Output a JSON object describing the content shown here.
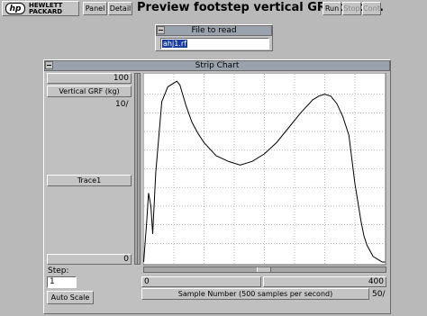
{
  "logo": {
    "line1": "HEWLETT",
    "line2": "PACKARD",
    "symbol": "hp"
  },
  "toolbar": {
    "panel_label": "Panel",
    "detail_label": "Detail",
    "run_label": "Run",
    "stop_label": "Stop",
    "cont_label": "Cont"
  },
  "app": {
    "title": "Preview footstep vertical GRF traces."
  },
  "file_panel": {
    "title": "File to read",
    "value": "ahj1.rf"
  },
  "strip_chart": {
    "title": "Strip Chart",
    "y_max": "100",
    "y_label": "Vertical GRF (kg)",
    "y_per_div": "10/",
    "trace_label": "Trace1",
    "y_min": "0",
    "step_label": "Step:",
    "step_value": "1",
    "auto_scale_label": "Auto Scale",
    "x_min": "0",
    "x_max": "400",
    "x_label": "Sample Number (500 samples per second)",
    "x_per_div": "50/"
  },
  "colors": {
    "background": "#b9b9b9",
    "titlebar": "#9aa3ad",
    "selection": "#1a3c9a",
    "trace": "#000000"
  },
  "chart_data": {
    "type": "line",
    "title": "Strip Chart",
    "xlabel": "Sample Number (500 samples per second)",
    "ylabel": "Vertical GRF (kg)",
    "xlim": [
      0,
      400
    ],
    "ylim": [
      0,
      100
    ],
    "grid": true,
    "series": [
      {
        "name": "Trace1",
        "x": [
          0,
          5,
          8,
          12,
          15,
          20,
          30,
          40,
          50,
          55,
          60,
          70,
          80,
          90,
          100,
          120,
          140,
          160,
          180,
          200,
          220,
          240,
          260,
          280,
          290,
          300,
          310,
          320,
          330,
          340,
          350,
          360,
          365,
          370,
          380,
          390,
          395,
          400
        ],
        "y": [
          0,
          22,
          37,
          30,
          15,
          48,
          86,
          94,
          96,
          97,
          95,
          84,
          75,
          69,
          64,
          57,
          54,
          52,
          54,
          58,
          64,
          72,
          80,
          87,
          89,
          90,
          89,
          85,
          78,
          68,
          42,
          22,
          14,
          9,
          3,
          1,
          0,
          0
        ]
      }
    ]
  }
}
